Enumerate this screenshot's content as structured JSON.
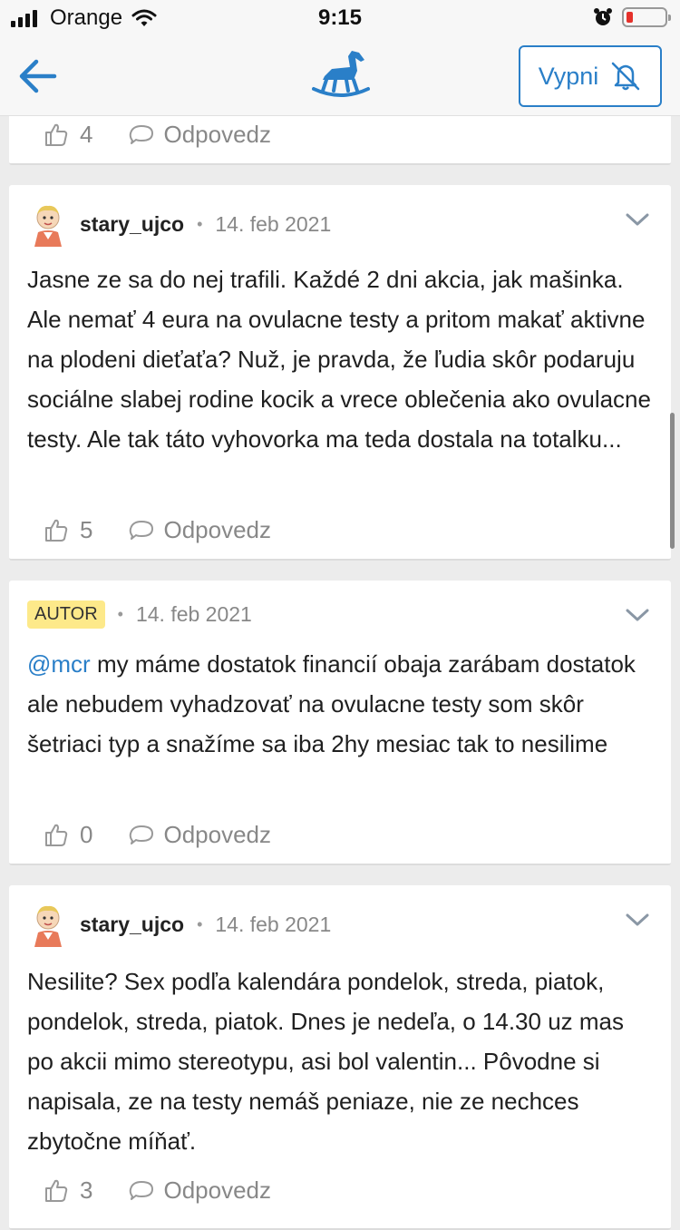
{
  "status_bar": {
    "carrier": "Orange",
    "time": "9:15"
  },
  "nav": {
    "mute_label": "Vypni"
  },
  "top_partial": {
    "likes": "4",
    "reply_label": "Odpovedz"
  },
  "comments": [
    {
      "username": "stary_ujco",
      "date": "14. feb 2021",
      "text": "Jasne ze sa do nej trafili. Každé 2 dni akcia, jak mašinka. Ale nemať 4 eura na ovulacne testy a pritom makať aktivne na plodeni dieťaťa? Nuž, je pravda, že ľudia skôr podaruju sociálne slabej rodine kocik a vrece oblečenia ako ovulacne testy. Ale tak táto vyhovorka ma teda dostala na totalku...",
      "likes": "5",
      "reply_label": "Odpovedz"
    },
    {
      "badge": "AUTOR",
      "date": "14. feb 2021",
      "mention": "@mcr",
      "text": " my máme dostatok financií obaja zarábam dostatok ale nebudem vyhadzovať na ovulacne testy som skôr šetriaci typ a snažíme sa iba 2hy mesiac tak to nesilime",
      "likes": "0",
      "reply_label": "Odpovedz"
    },
    {
      "username": "stary_ujco",
      "date": "14. feb 2021",
      "text": "Nesilite? Sex podľa kalendára pondelok, streda, piatok, pondelok, streda, piatok. Dnes je nedeľa, o 14.30 uz mas po akcii mimo stereotypu, asi bol valentin... Pôvodne si napisala, ze na testy nemáš peniaze, nie ze nechces zbytočne míňať.",
      "likes": "3",
      "reply_label": "Odpovedz"
    }
  ],
  "colors": {
    "accent": "#2a7fc8",
    "badge": "#fde98a",
    "muted": "#888888"
  }
}
